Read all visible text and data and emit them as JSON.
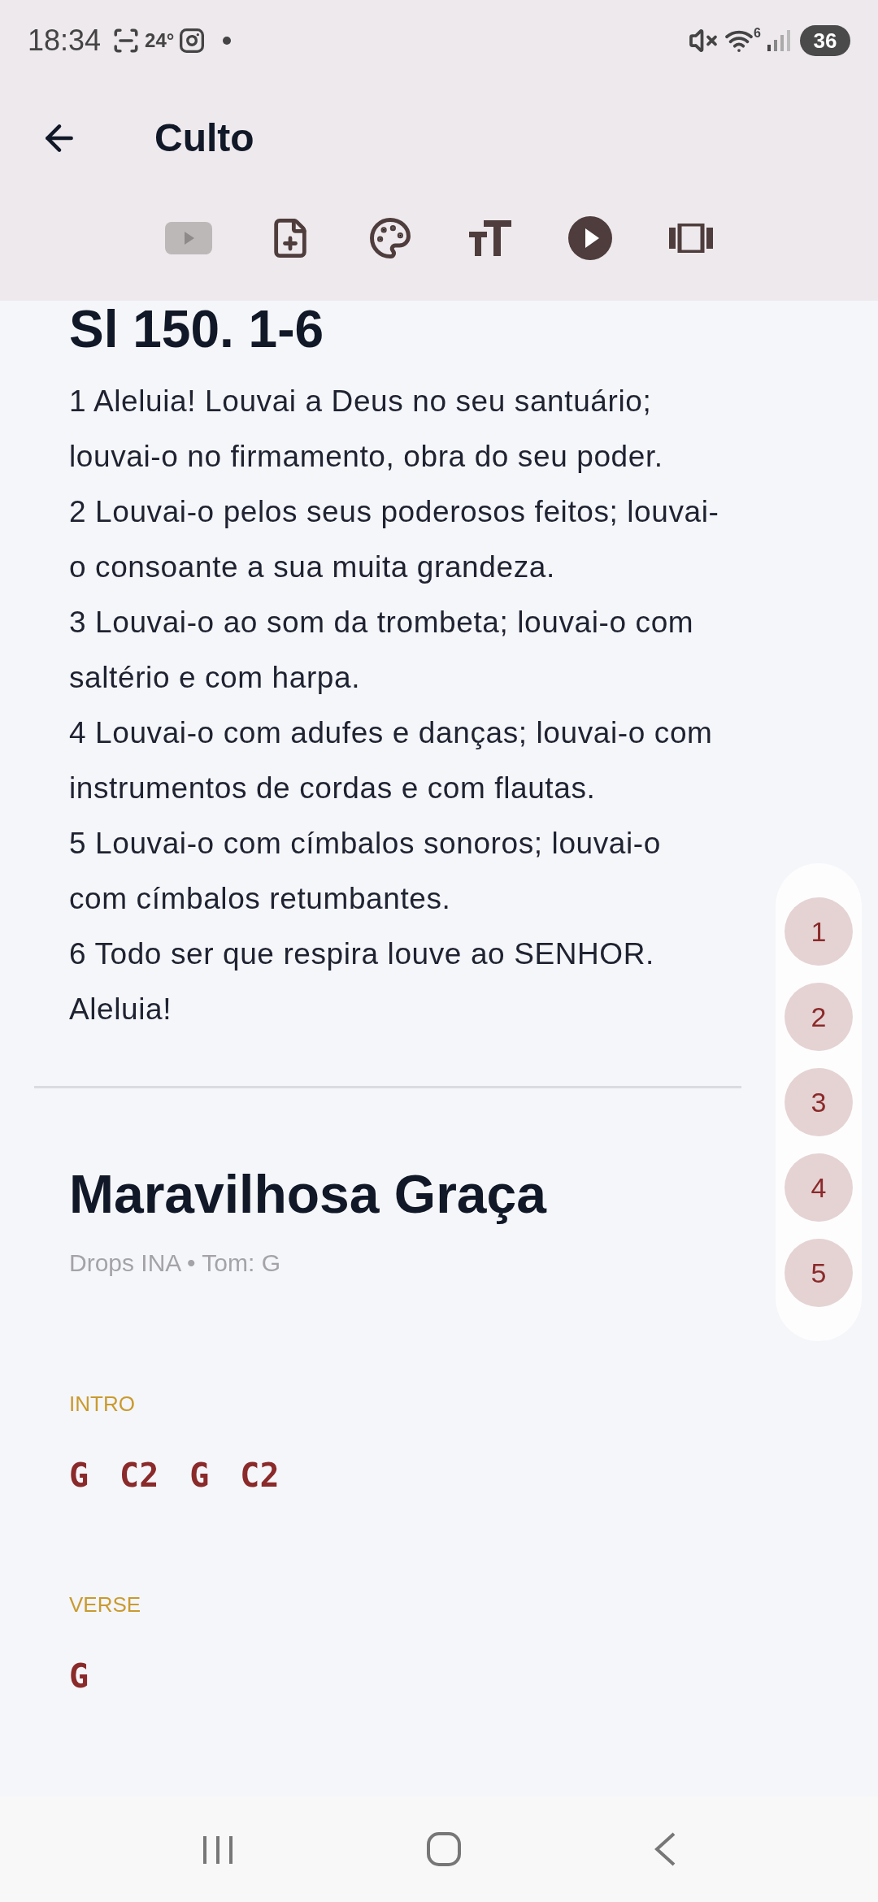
{
  "status_bar": {
    "time": "18:34",
    "temperature": "24°",
    "wifi_label": "6",
    "battery": "36"
  },
  "app_bar": {
    "title": "Culto"
  },
  "toolbar": [
    {
      "kind": "video",
      "disabled": true
    },
    {
      "kind": "add-file",
      "disabled": false
    },
    {
      "kind": "palette",
      "disabled": false
    },
    {
      "kind": "text-size",
      "disabled": false
    },
    {
      "kind": "play",
      "disabled": false
    },
    {
      "kind": "carousel",
      "disabled": false
    }
  ],
  "reading": {
    "heading": "Sl 150. 1-6",
    "verses": [
      "1 Aleluia! Louvai a Deus no seu santuário; louvai-o no firmamento, obra do seu poder.",
      "2 Louvai-o pelos seus poderosos feitos; louvai-o consoante a sua muita grandeza.",
      "3 Louvai-o ao som da trombeta; louvai-o com saltério e com harpa.",
      "4 Louvai-o com adufes e danças; louvai-o com instrumentos de cordas e com flautas.",
      "5 Louvai-o com címbalos sonoros; louvai-o com címbalos retumbantes.",
      "6 Todo ser que respira louve ao SENHOR. Aleluia!"
    ]
  },
  "verse_index": [
    "1",
    "2",
    "3",
    "4",
    "5"
  ],
  "song": {
    "title": "Maravilhosa Graça",
    "subtitle": "Drops INA • Tom: G",
    "sections": [
      {
        "label": "INTRO",
        "chords": [
          "G",
          "C2",
          "G",
          "C2"
        ]
      },
      {
        "label": "VERSE",
        "chords": [
          "G"
        ]
      }
    ]
  }
}
